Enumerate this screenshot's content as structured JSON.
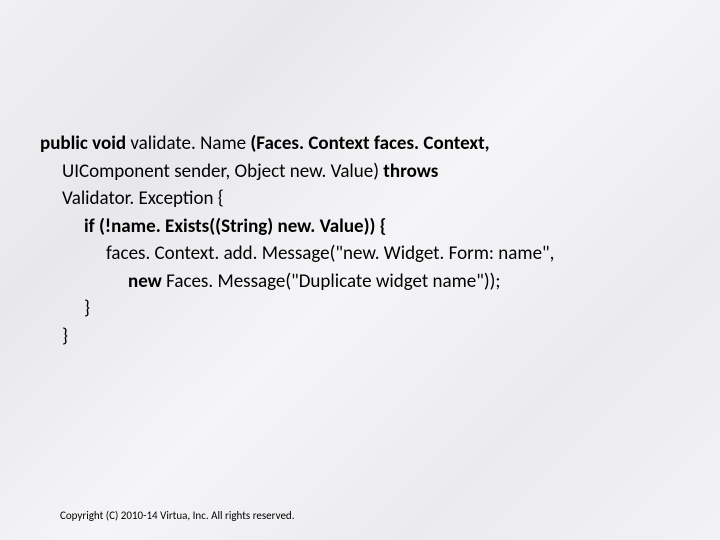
{
  "code": {
    "line1_prefix": "public void ",
    "line1_method": "validate. Name ",
    "line1_params": "(Faces. Context faces. Context,",
    "line2_params": "UIComponent sender, Object new. Value) ",
    "line2_throws": "throws",
    "line3": "Validator. Exception  {",
    "line4_if": "if ",
    "line4_cond": "(!name. Exists((String) new. Value)) {",
    "line5": "faces. Context. add. Message(\"new. Widget. Form: name\",",
    "line6_new": "new ",
    "line6_rest": "Faces. Message(\"Duplicate widget name\"));",
    "line7": "}",
    "line8": "}"
  },
  "footer": {
    "copyright": "Copyright (C) 2010-14 Virtua, Inc. All rights reserved."
  }
}
